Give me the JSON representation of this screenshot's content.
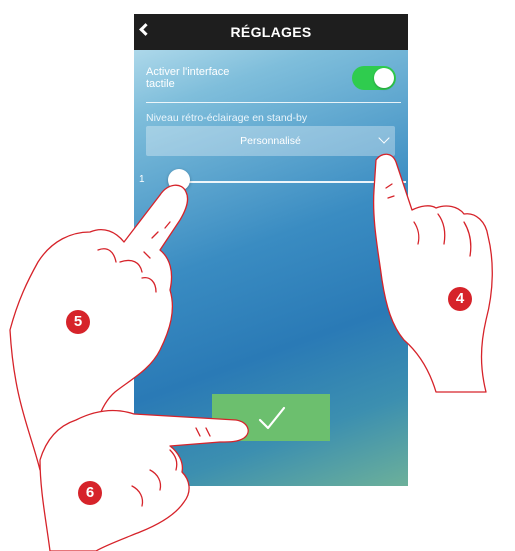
{
  "header": {
    "title": "RÉGLAGES",
    "back_icon": "chevron-left-icon"
  },
  "settings": {
    "touch_interface_label": "Activer l'interface\ntactile",
    "touch_interface_enabled": true,
    "backlight_label": "Niveau rétro-éclairage en stand-by",
    "backlight_mode": "Personnalisé",
    "slider_min_label": "1",
    "slider_value_fraction": 0
  },
  "confirm_icon": "checkmark-icon",
  "callouts": [
    "4",
    "5",
    "6"
  ],
  "colors": {
    "accent_red": "#d6232a",
    "toggle_green": "#2fcc4e",
    "confirm_green": "#6cbf6e",
    "header_bg": "#1e1e1e"
  }
}
